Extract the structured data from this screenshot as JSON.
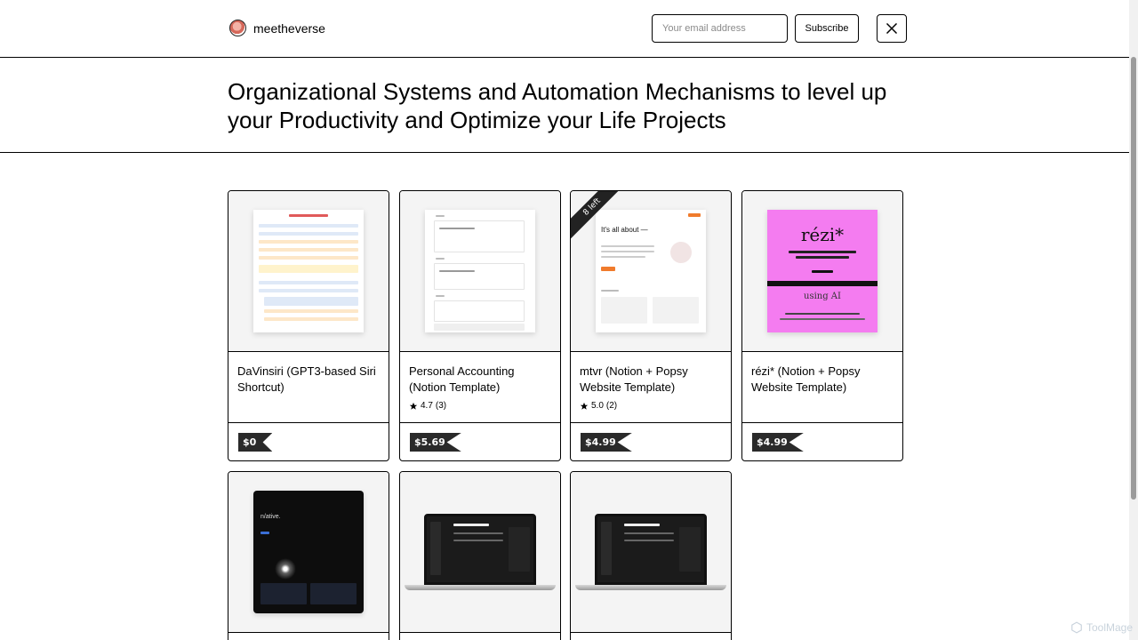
{
  "header": {
    "brand_name": "meetheverse",
    "email_placeholder": "Your email address",
    "subscribe_label": "Subscribe",
    "x_icon": "x-logo-icon"
  },
  "page": {
    "title": "Organizational Systems and Automation Mechanisms to level up your Productivity and Optimize your Life Projects"
  },
  "products": [
    {
      "title": "DaVinsiri (GPT3-based Siri Shortcut)",
      "rating": "",
      "reviews": "",
      "price": "$0",
      "ribbon": ""
    },
    {
      "title": "Personal Accounting (Notion Template)",
      "rating": "4.7",
      "reviews": "(3)",
      "price": "$5.69",
      "ribbon": ""
    },
    {
      "title": "mtvr (Notion + Popsy Website Template)",
      "rating": "5.0",
      "reviews": "(2)",
      "price": "$4.99",
      "ribbon": "8 left"
    },
    {
      "title": "rézi* (Notion + Popsy Website Template)",
      "rating": "",
      "reviews": "",
      "price": "$4.99",
      "ribbon": ""
    }
  ],
  "thumb_text": {
    "mtvr_heading": "It's all about —",
    "rezi_logo": "rézi*",
    "rezi_using": "using AI",
    "native_logo": "n/ative."
  },
  "colors": {
    "accent_pink": "#f47cf0",
    "price_tag": "#2a2a2a",
    "border": "#000000"
  },
  "watermark": "ToolMage"
}
